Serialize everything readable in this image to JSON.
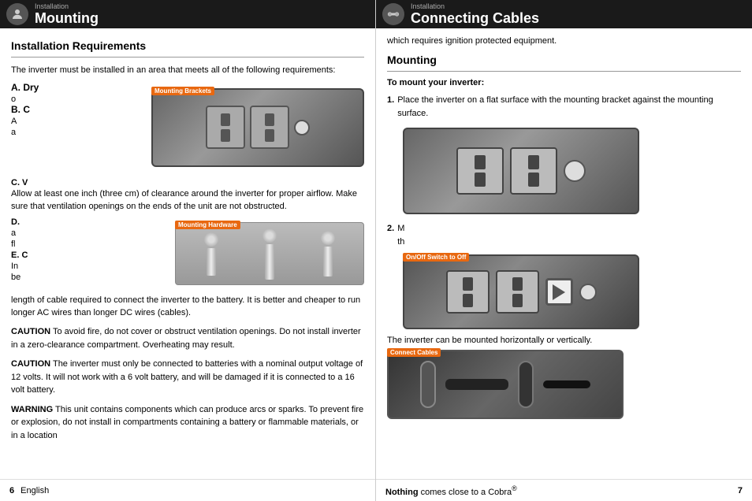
{
  "left": {
    "header": {
      "title": "Mounting",
      "installation_label": "Installation"
    },
    "section_title": "Installation Requirements",
    "intro_text": "The inverter must be installed in an area that meets all of the following requirements:",
    "requirements": [
      {
        "letter": "A.",
        "label": "Dry",
        "text": "o",
        "overlay": "Mounting Brackets"
      },
      {
        "letter": "B.",
        "label": "C",
        "text": "A a"
      },
      {
        "letter": "C.",
        "label": "V",
        "text": "Allow at least one inch (three cm) of clearance around the inverter for proper airflow. Make sure that ventilation openings on the ends of the unit are not obstructed.",
        "overlay": "Mounting Hardware"
      },
      {
        "letter": "D.",
        "text": "a fl"
      },
      {
        "letter": "E.",
        "label": "C",
        "text": "In be"
      }
    ],
    "cable_text": "length of cable required to connect the inverter to the battery. It is better and cheaper to run longer AC wires than longer DC wires (cables).",
    "caution1": {
      "label": "CAUTION",
      "text": "To avoid fire, do not cover or obstruct ventilation openings. Do not install inverter in a zero-clearance compartment. Overheating may result."
    },
    "caution2": {
      "label": "CAUTION",
      "text": "The inverter must only be connected to batteries with a nominal output voltage of 12 volts. It will not work with a 6 volt battery, and will be damaged if it is connected to a 16 volt battery."
    },
    "warning": {
      "label": "WARNING",
      "text": "This unit contains components which can produce arcs or sparks. To prevent fire or explosion, do not install in compartments containing a battery or flammable materials, or in a location"
    },
    "footer": {
      "page_num": "6",
      "lang": "English"
    }
  },
  "right": {
    "header": {
      "title": "Connecting Cables",
      "installation_label": "Installation"
    },
    "intro_text": "which requires ignition protected equipment.",
    "mounting_title": "Mounting",
    "to_mount_label": "To mount your inverter:",
    "steps": [
      {
        "num": "1.",
        "text": "Place the inverter on a flat surface with the mounting bracket against the mounting surface."
      },
      {
        "num": "2.",
        "text": "M th",
        "overlay": "On/Off Switch to Off"
      }
    ],
    "horizontal_text": "The inverter can be mounted horizontally or vertically.",
    "connect_cables_overlay": "Connect Cables",
    "footer": {
      "tagline_start": "Nothing",
      "tagline_end": " comes close to a Cobra",
      "trademark": "®",
      "page_num": "7"
    }
  }
}
